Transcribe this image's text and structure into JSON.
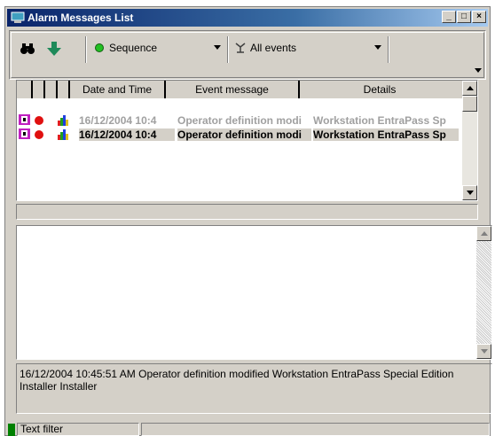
{
  "window": {
    "title": "Alarm Messages List"
  },
  "titlebar_buttons": {
    "minimize": "_",
    "restore": "□",
    "close": "×"
  },
  "toolbar": {
    "sequence_label": "Sequence",
    "sequence_color": "#22c022",
    "events_label": "All events"
  },
  "grid": {
    "columns": [
      "",
      "",
      "",
      "",
      "Date and Time",
      "Event message",
      "Details"
    ],
    "rows": [
      {
        "date": "16/12/2004 10:4",
        "message": "Operator definition modi",
        "details": "Workstation EntraPass Sp",
        "state": "dim"
      },
      {
        "date": "16/12/2004 10:4",
        "message": "Operator definition modi",
        "details": "Workstation EntraPass Sp",
        "state": "selected"
      }
    ]
  },
  "info": {
    "text": "16/12/2004 10:45:51 AM  Operator definition modified  Workstation EntraPass Special Edition  Installer  Installer"
  },
  "statusbar": {
    "filter_label": "Text filter"
  }
}
